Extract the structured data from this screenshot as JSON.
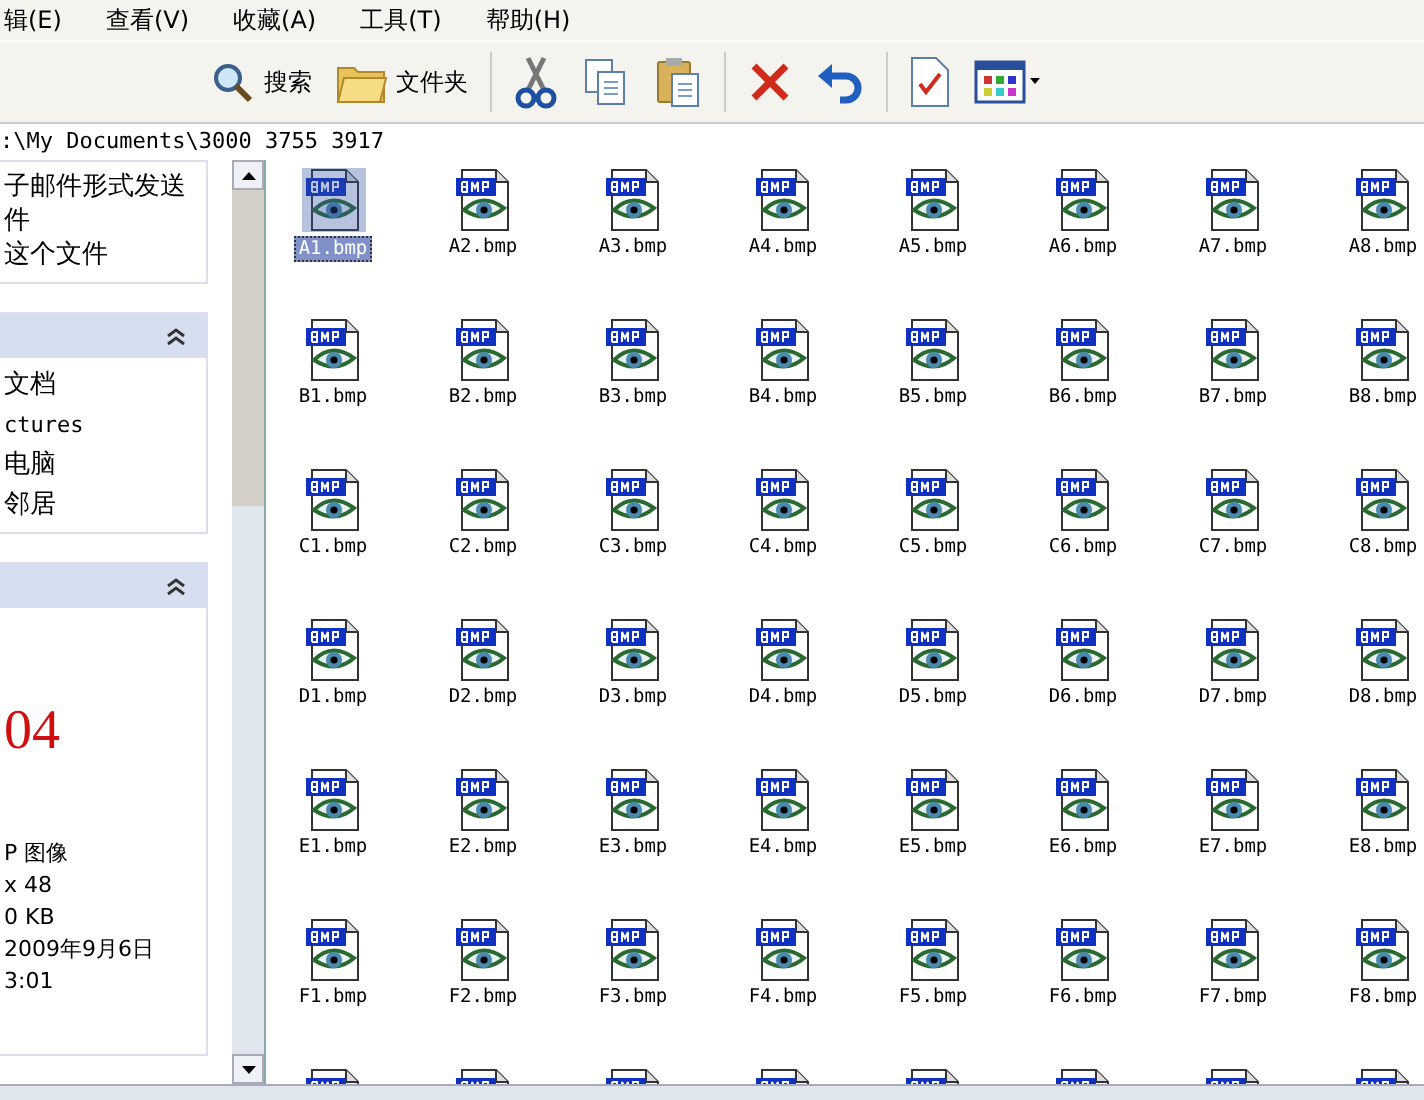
{
  "menu": [
    "辑(E)",
    "查看(V)",
    "收藏(A)",
    "工具(T)",
    "帮助(H)"
  ],
  "toolbar": [
    {
      "kind": "search",
      "label": "搜索"
    },
    {
      "kind": "folder",
      "label": "文件夹"
    },
    {
      "kind": "sep"
    },
    {
      "kind": "cut"
    },
    {
      "kind": "copy"
    },
    {
      "kind": "paste"
    },
    {
      "kind": "sep"
    },
    {
      "kind": "delete"
    },
    {
      "kind": "undo"
    },
    {
      "kind": "sep"
    },
    {
      "kind": "properties"
    },
    {
      "kind": "views"
    }
  ],
  "address": ":\\My Documents\\3000 3755 3917",
  "tasks": {
    "lines": [
      "子邮件形式发送",
      "件",
      "这个文件"
    ]
  },
  "places": {
    "expanded": true,
    "items": [
      "文档",
      "ctures",
      "电脑",
      "邻居"
    ]
  },
  "details": {
    "expanded": true,
    "title": "04",
    "lines": [
      "P 图像",
      "x 48",
      "0 KB",
      "2009年9月6日",
      "3:01"
    ]
  },
  "files": [
    {
      "kind": "file",
      "label": "A1.bmp",
      "selected": true
    },
    {
      "kind": "file",
      "label": "A2.bmp",
      "selected": false
    },
    {
      "kind": "file",
      "label": "A3.bmp",
      "selected": false
    },
    {
      "kind": "file",
      "label": "A4.bmp",
      "selected": false
    },
    {
      "kind": "file",
      "label": "A5.bmp",
      "selected": false
    },
    {
      "kind": "file",
      "label": "A6.bmp",
      "selected": false
    },
    {
      "kind": "file",
      "label": "A7.bmp",
      "selected": false
    },
    {
      "kind": "file",
      "label": "A8.bmp",
      "selected": false
    },
    {
      "kind": "file",
      "label": "B1.bmp",
      "selected": false
    },
    {
      "kind": "file",
      "label": "B2.bmp",
      "selected": false
    },
    {
      "kind": "file",
      "label": "B3.bmp",
      "selected": false
    },
    {
      "kind": "file",
      "label": "B4.bmp",
      "selected": false
    },
    {
      "kind": "file",
      "label": "B5.bmp",
      "selected": false
    },
    {
      "kind": "file",
      "label": "B6.bmp",
      "selected": false
    },
    {
      "kind": "file",
      "label": "B7.bmp",
      "selected": false
    },
    {
      "kind": "file",
      "label": "B8.bmp",
      "selected": false
    },
    {
      "kind": "file",
      "label": "C1.bmp",
      "selected": false
    },
    {
      "kind": "file",
      "label": "C2.bmp",
      "selected": false
    },
    {
      "kind": "file",
      "label": "C3.bmp",
      "selected": false
    },
    {
      "kind": "file",
      "label": "C4.bmp",
      "selected": false
    },
    {
      "kind": "file",
      "label": "C5.bmp",
      "selected": false
    },
    {
      "kind": "file",
      "label": "C6.bmp",
      "selected": false
    },
    {
      "kind": "file",
      "label": "C7.bmp",
      "selected": false
    },
    {
      "kind": "file",
      "label": "C8.bmp",
      "selected": false
    },
    {
      "kind": "file",
      "label": "D1.bmp",
      "selected": false
    },
    {
      "kind": "file",
      "label": "D2.bmp",
      "selected": false
    },
    {
      "kind": "file",
      "label": "D3.bmp",
      "selected": false
    },
    {
      "kind": "file",
      "label": "D4.bmp",
      "selected": false
    },
    {
      "kind": "file",
      "label": "D5.bmp",
      "selected": false
    },
    {
      "kind": "file",
      "label": "D6.bmp",
      "selected": false
    },
    {
      "kind": "file",
      "label": "D7.bmp",
      "selected": false
    },
    {
      "kind": "file",
      "label": "D8.bmp",
      "selected": false
    },
    {
      "kind": "file",
      "label": "E1.bmp",
      "selected": false
    },
    {
      "kind": "file",
      "label": "E2.bmp",
      "selected": false
    },
    {
      "kind": "file",
      "label": "E3.bmp",
      "selected": false
    },
    {
      "kind": "file",
      "label": "E4.bmp",
      "selected": false
    },
    {
      "kind": "file",
      "label": "E5.bmp",
      "selected": false
    },
    {
      "kind": "file",
      "label": "E6.bmp",
      "selected": false
    },
    {
      "kind": "file",
      "label": "E7.bmp",
      "selected": false
    },
    {
      "kind": "file",
      "label": "E8.bmp",
      "selected": false
    },
    {
      "kind": "file",
      "label": "F1.bmp",
      "selected": false
    },
    {
      "kind": "file",
      "label": "F2.bmp",
      "selected": false
    },
    {
      "kind": "file",
      "label": "F3.bmp",
      "selected": false
    },
    {
      "kind": "file",
      "label": "F4.bmp",
      "selected": false
    },
    {
      "kind": "file",
      "label": "F5.bmp",
      "selected": false
    },
    {
      "kind": "file",
      "label": "F6.bmp",
      "selected": false
    },
    {
      "kind": "file",
      "label": "F7.bmp",
      "selected": false
    },
    {
      "kind": "file",
      "label": "F8.bmp",
      "selected": false
    },
    {
      "kind": "partial"
    },
    {
      "kind": "partial"
    },
    {
      "kind": "partial"
    },
    {
      "kind": "partial"
    },
    {
      "kind": "partial"
    },
    {
      "kind": "partial"
    },
    {
      "kind": "partial"
    },
    {
      "kind": "partial"
    }
  ]
}
